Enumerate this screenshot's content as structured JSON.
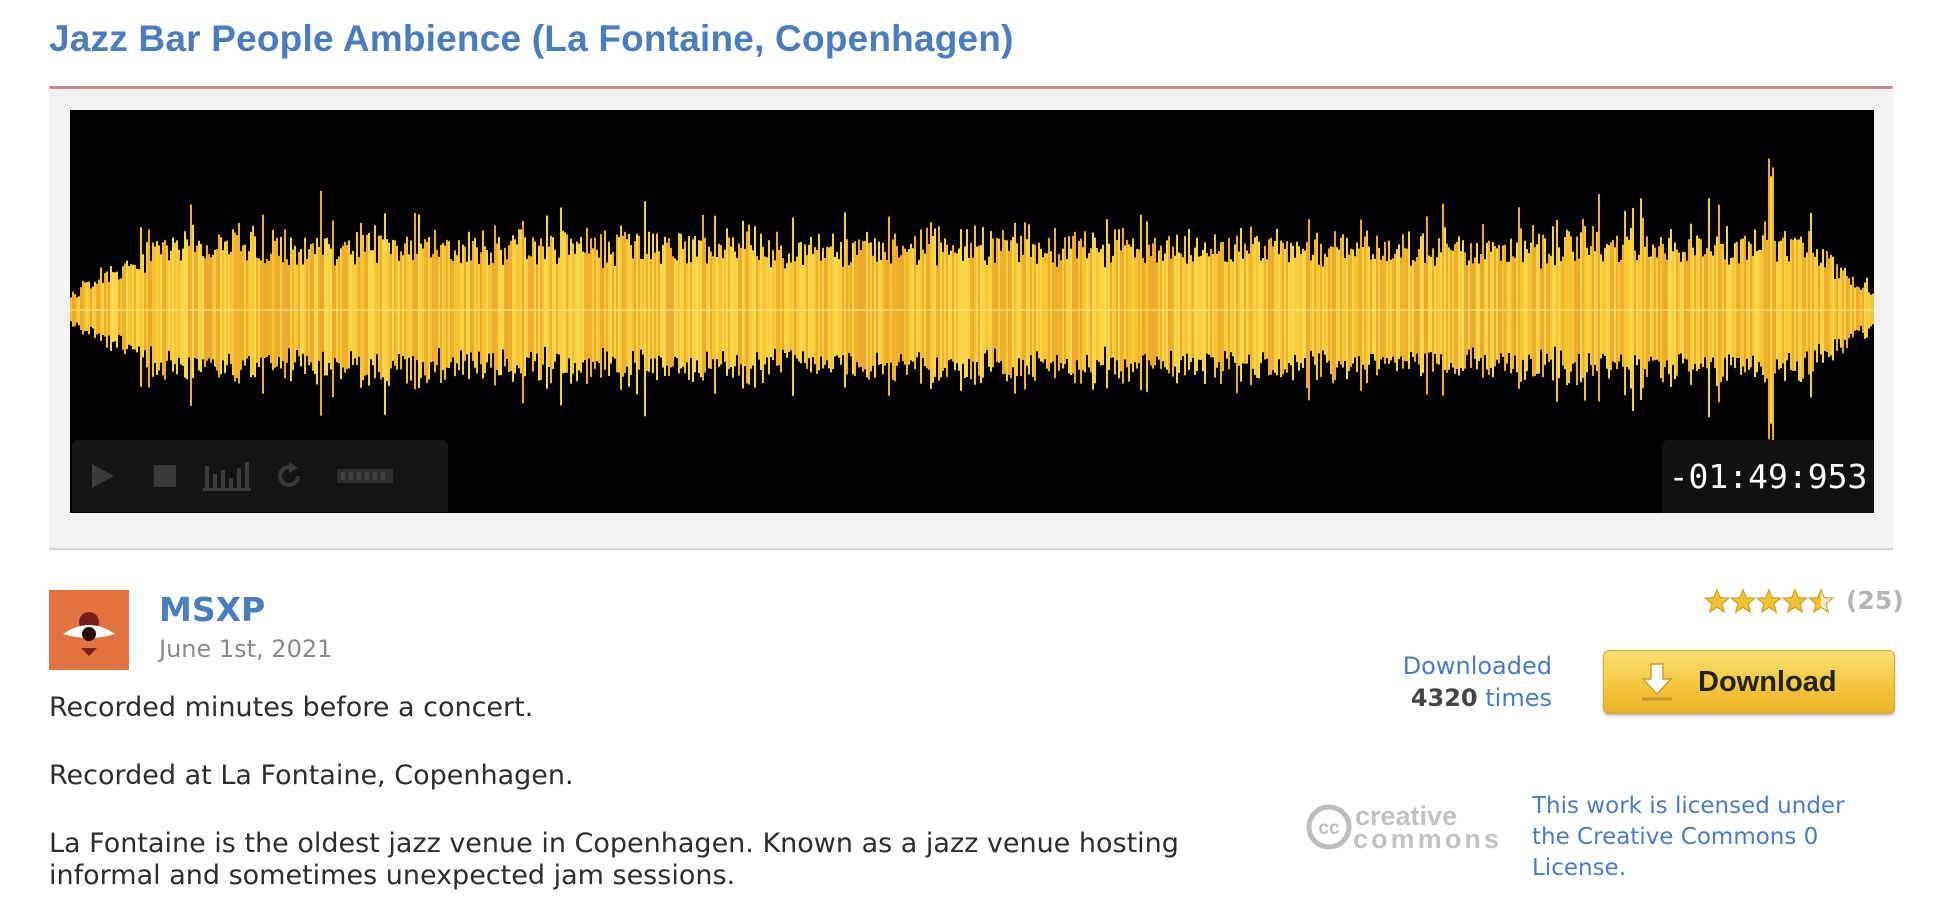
{
  "sound": {
    "title": "Jazz Bar People Ambience (La Fontaine, Copenhagen)"
  },
  "player": {
    "time_display": "-01:49:953",
    "controls": [
      "play-icon",
      "stop-icon",
      "spectrogram-icon",
      "loop-icon",
      "volume-icon"
    ],
    "waveform_color": "#f7c434",
    "background_color": "#000000"
  },
  "author": {
    "username": "MSXP",
    "upload_date": "June 1st, 2021"
  },
  "description": {
    "paragraphs": [
      "Recorded minutes before a concert.",
      "Recorded at La Fontaine, Copenhagen.",
      "La Fontaine is the oldest jazz venue in Copenhagen. Known as a jazz venue hosting informal and sometimes unexpected jam sessions."
    ]
  },
  "rating": {
    "stars": 4.5,
    "max_stars": 5,
    "count_text": "(25)"
  },
  "downloads": {
    "prefix": "Downloaded",
    "count": "4320",
    "suffix": "times"
  },
  "download_button": {
    "label": "Download"
  },
  "license": {
    "logo_text_top": "creative",
    "logo_text_bottom": "commons",
    "text": "This work is licensed under the Creative Commons 0 License."
  },
  "colors": {
    "link_blue": "#4a7dbf",
    "accent_yellow": "#f3c53a",
    "avatar_orange": "#e0733f"
  }
}
